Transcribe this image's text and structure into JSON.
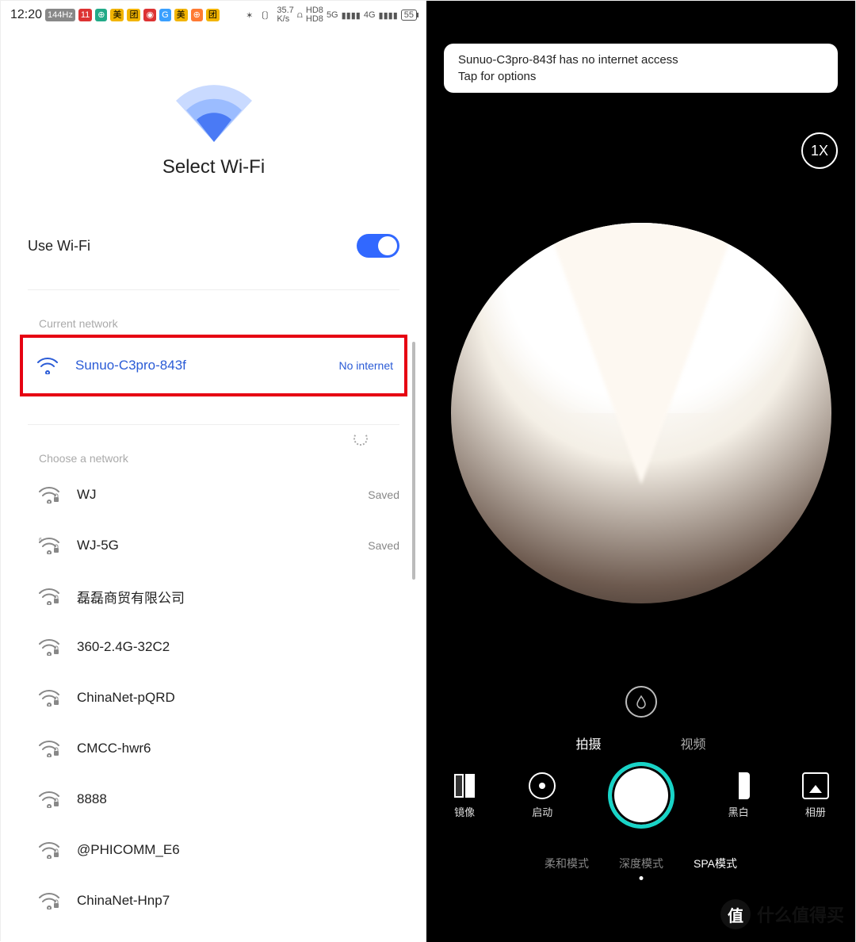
{
  "status_bar": {
    "time": "12:20",
    "fps_badge": "144Hz",
    "icons": [
      "11",
      "⊕",
      "美团",
      "微博",
      "⊕",
      "美团",
      "⊕",
      "美团"
    ],
    "bt": "✻",
    "vibrate": "〔〕",
    "speed": "35.7\nK/s",
    "wifi": "⩍",
    "hd": "HD8\nHD8",
    "sig1": "5G",
    "sig2": "4G",
    "battery": "55"
  },
  "left": {
    "title": "Select Wi-Fi",
    "use_label": "Use Wi-Fi",
    "toggle_on": true,
    "section_current": "Current network",
    "current": {
      "name": "Sunuo-C3pro-843f",
      "status": "No internet"
    },
    "section_choose": "Choose a network",
    "networks": [
      {
        "name": "WJ",
        "status": "Saved",
        "lock": true
      },
      {
        "name": "WJ-5G",
        "status": "Saved",
        "lock": true,
        "band": "6"
      },
      {
        "name": "磊磊商贸有限公司",
        "status": "",
        "lock": true
      },
      {
        "name": "360-2.4G-32C2",
        "status": "",
        "lock": true
      },
      {
        "name": "ChinaNet-pQRD",
        "status": "",
        "lock": true
      },
      {
        "name": "CMCC-hwr6",
        "status": "",
        "lock": true
      },
      {
        "name": "8888",
        "status": "",
        "lock": true
      },
      {
        "name": "@PHICOMM_E6",
        "status": "",
        "lock": true
      },
      {
        "name": "ChinaNet-Hnp7",
        "status": "",
        "lock": true
      }
    ]
  },
  "right": {
    "toast_line1": "Sunuo-C3pro-843f has no internet access",
    "toast_line2": "Tap for options",
    "zoom": "1X",
    "tabs": {
      "photo": "拍摄",
      "video": "视频"
    },
    "controls": {
      "mirror": "镜像",
      "start": "启动",
      "bw": "黑白",
      "album": "相册"
    },
    "modes": {
      "soft": "柔和模式",
      "deep": "深度模式",
      "spa": "SPA模式"
    }
  },
  "watermark": "什么值得买",
  "watermark_badge": "值"
}
